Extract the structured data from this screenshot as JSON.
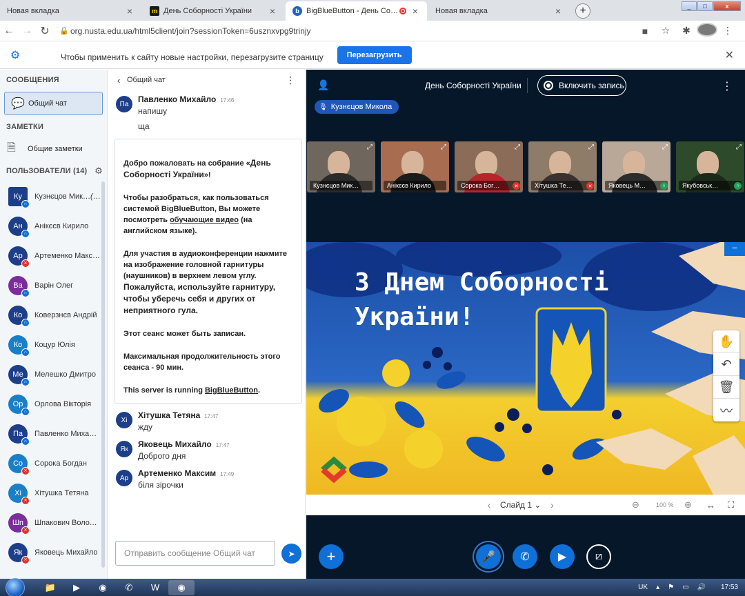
{
  "browser": {
    "tabs": [
      {
        "title": "Новая вкладка",
        "favicon": "none",
        "active": false
      },
      {
        "title": "День Соборності України",
        "favicon": "doc-icon",
        "active": false
      },
      {
        "title": "BigBlueButton - День Собор",
        "favicon": "bbb-icon",
        "active": true
      },
      {
        "title": "Новая вкладка",
        "favicon": "none",
        "active": false
      }
    ],
    "url": "org.nusta.edu.ua/html5client/join?sessionToken=6usznxvpg9trinjy",
    "infobar_message": "Чтобы применить к сайту новые настройки, перезагрузите страницу",
    "reload_label": "Перезагрузить"
  },
  "sidebar": {
    "messages_heading": "СООБЩЕНИЯ",
    "public_chat": "Общий чат",
    "notes_heading": "ЗАМЕТКИ",
    "shared_notes": "Общие заметки",
    "users_heading": "ПОЛЬЗОВАТЕЛИ (14)",
    "users": [
      {
        "initials": "Ку",
        "name": "Кузнєцов Мик…",
        "you": "(Вы)",
        "color": "#1d3f8a",
        "status": "listen",
        "square": true
      },
      {
        "initials": "Ан",
        "name": "Анікєєв Кирило",
        "color": "#1d3f8a",
        "status": "listen"
      },
      {
        "initials": "Ар",
        "name": "Артеменко Максим",
        "color": "#1d3f8a",
        "status": "mute"
      },
      {
        "initials": "Ва",
        "name": "Варін Олег",
        "color": "#7b2d9b",
        "status": "listen"
      },
      {
        "initials": "Ко",
        "name": "Коверзнєв Андрій",
        "color": "#1d3f8a",
        "status": "listen"
      },
      {
        "initials": "Ко",
        "name": "Коцур Юлія",
        "color": "#1a7fc9",
        "status": "listen"
      },
      {
        "initials": "Ме",
        "name": "Мелешко Дмитро",
        "color": "#1d3f8a",
        "status": "listen"
      },
      {
        "initials": "Ор",
        "name": "Орлова Вікторія",
        "color": "#1a7fc9",
        "status": "listen"
      },
      {
        "initials": "Па",
        "name": "Павленко Михайло",
        "color": "#1d3f8a",
        "status": "listen"
      },
      {
        "initials": "Со",
        "name": "Сорока Богдан",
        "color": "#1a7fc9",
        "status": "mute"
      },
      {
        "initials": "Хі",
        "name": "Хітушка Тетяна",
        "color": "#1a7fc9",
        "status": "mute"
      },
      {
        "initials": "Шп",
        "name": "Шпакович Волод…",
        "color": "#7b2d9b",
        "status": "mute"
      },
      {
        "initials": "Як",
        "name": "Яковець Михайло",
        "color": "#1d3f8a",
        "status": "mute"
      }
    ]
  },
  "chat": {
    "title": "Общий чат",
    "messages_top": [
      {
        "initials": "Па",
        "name": "Павленко Михайло",
        "time": "17:46",
        "lines": [
          "напишу",
          "ща"
        ]
      }
    ],
    "welcome": {
      "p1_a": "Добро пожаловать на собрание «",
      "p1_b": "День Соборності України",
      "p1_c": "»!",
      "p2_a": "Чтобы разобраться, как пользоваться системой BigBlueButton, Вы можете посмотреть ",
      "p2_link": "обучающие видео",
      "p2_b": " (на английском языке).",
      "p3_a": "Для участия в аудиоконференции нажмите на изображение головной гарнитуры (наушников) в верхнем левом углу. ",
      "p3_b": "Пожалуйста, используйте гарнитуру, чтобы уберечь себя и других от неприятного гула.",
      "p4": "Этот сеанс может быть записан.",
      "p5": "Максимальная продолжительность этого сеанса - 90 мин.",
      "p6_a": "This server is running ",
      "p6_link": "BigBlueButton",
      "p6_b": "."
    },
    "messages_bottom": [
      {
        "initials": "Хі",
        "name": "Хітушка Тетяна",
        "time": "17:47",
        "lines": [
          "жду"
        ]
      },
      {
        "initials": "Як",
        "name": "Яковець Михайло",
        "time": "17:47",
        "lines": [
          "Доброго дня"
        ]
      },
      {
        "initials": "Ар",
        "name": "Артеменко Максим",
        "time": "17:49",
        "lines": [
          "біля зірочки"
        ]
      }
    ],
    "input_placeholder": "Отправить сообщение Общий чат"
  },
  "meeting": {
    "title": "День Соборності України",
    "record_label": "Включить запись",
    "talking": "Кузнєцов Микола",
    "videos": [
      {
        "name": "Кузнєцов Мик…",
        "bg": "#6f665e",
        "shirt": "#2b2b2b",
        "state": "none"
      },
      {
        "name": "Анікєєв Кирило",
        "bg": "#a86c50",
        "shirt": "#1c1c1c",
        "state": "none"
      },
      {
        "name": "Сорока Бог…",
        "bg": "#8a6c58",
        "shirt": "#b5252a",
        "state": "mute"
      },
      {
        "name": "Хітушка Те…",
        "bg": "#8e7b68",
        "shirt": "#3a3230",
        "state": "mute"
      },
      {
        "name": "Яковець М…",
        "bg": "#b9a898",
        "shirt": "#2d2d2d",
        "state": "listen"
      },
      {
        "name": "Якубовськ…",
        "bg": "#2d4a2a",
        "shirt": "#1c2a1a",
        "state": "listen"
      }
    ],
    "slide_text_1": "З Днем Соборності",
    "slide_text_2": "України!",
    "slide_label": "Слайд 1",
    "zoom": "100 %"
  },
  "taskbar": {
    "lang": "UK",
    "time": "17:53"
  },
  "colors": {
    "accent": "#0f70d7",
    "dark": "#06172a",
    "ua_blue": "#1555b8",
    "ua_yellow": "#f5d22b"
  }
}
